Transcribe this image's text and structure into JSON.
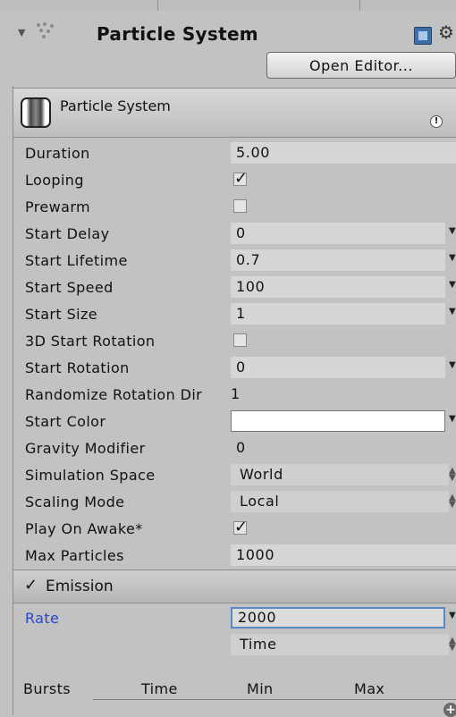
{
  "header": {
    "title": "Particle System",
    "open_editor_label": "Open Editor..."
  },
  "module": {
    "name": "Particle System"
  },
  "properties": [
    {
      "label": "Duration",
      "value": "5.00",
      "type": "number"
    },
    {
      "label": "Looping",
      "checked": true,
      "type": "checkbox"
    },
    {
      "label": "Prewarm",
      "checked": false,
      "type": "checkbox"
    },
    {
      "label": "Start Delay",
      "value": "0",
      "type": "curve"
    },
    {
      "label": "Start Lifetime",
      "value": "0.7",
      "type": "curve"
    },
    {
      "label": "Start Speed",
      "value": "100",
      "type": "curve"
    },
    {
      "label": "Start Size",
      "value": "1",
      "type": "curve"
    },
    {
      "label": "3D Start Rotation",
      "checked": false,
      "type": "checkbox"
    },
    {
      "label": "Start Rotation",
      "value": "0",
      "type": "curve"
    },
    {
      "label": "Randomize Rotation Dir",
      "value": "1",
      "type": "plain"
    },
    {
      "label": "Start Color",
      "value": "",
      "color": "#ffffff",
      "type": "color"
    },
    {
      "label": "Gravity Modifier",
      "value": "0",
      "type": "plain"
    },
    {
      "label": "Simulation Space",
      "value": "World",
      "type": "select"
    },
    {
      "label": "Scaling Mode",
      "value": "Local",
      "type": "select"
    },
    {
      "label": "Play On Awake*",
      "checked": true,
      "type": "checkbox"
    },
    {
      "label": "Max Particles",
      "value": "1000",
      "type": "number"
    }
  ],
  "emission": {
    "enabled": true,
    "check_glyph": "✓",
    "title": "Emission",
    "rate_label": "Rate",
    "rate_value": "2000",
    "rate_mode": "Time",
    "bursts_label": "Bursts",
    "bursts_columns": [
      "Time",
      "Min",
      "Max"
    ]
  },
  "glyphs": {
    "check": "✓",
    "caret": "▼",
    "updown": "▲▼",
    "gear": "⚙",
    "fold": "▼",
    "plus": "+",
    "warn": "!"
  },
  "colors": {
    "rate_label": "#2947c8",
    "active_border": "#5b87c8",
    "panel_bg": "#c2c2c2"
  }
}
